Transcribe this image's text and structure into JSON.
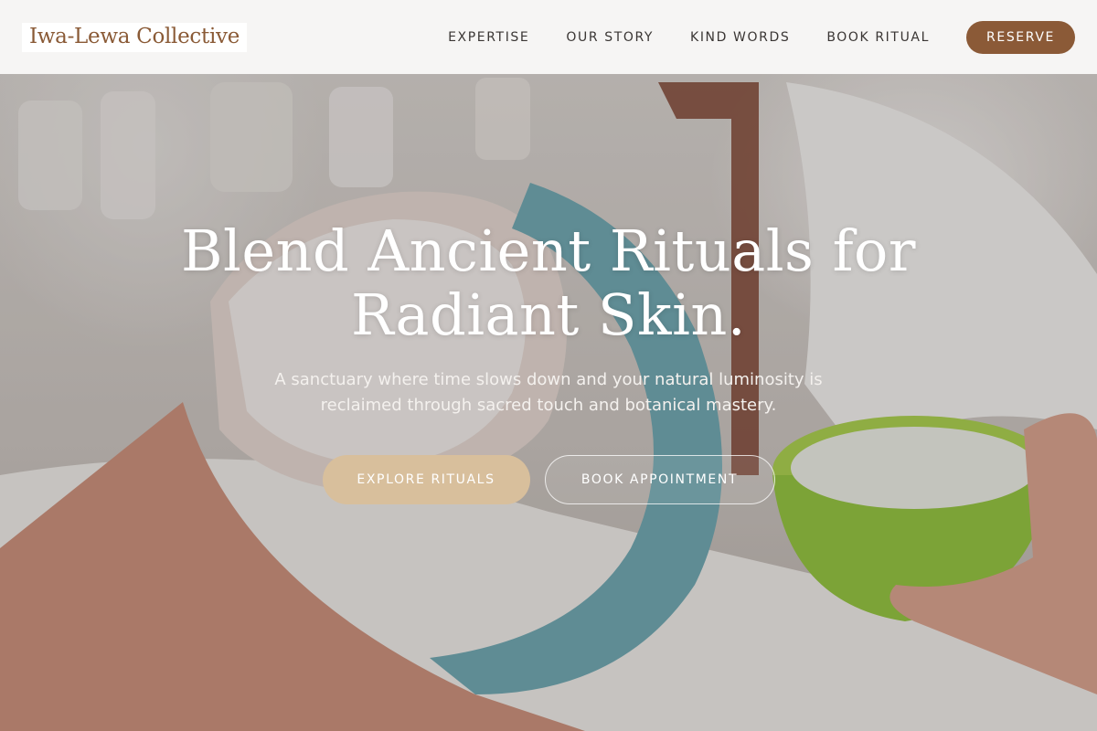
{
  "header": {
    "logo": "Iwa-Lewa Collective",
    "nav": [
      "EXPERTISE",
      "OUR STORY",
      "KIND WORDS",
      "BOOK RITUAL"
    ],
    "reserve_label": "RESERVE"
  },
  "hero": {
    "title": "Blend Ancient Rituals for Radiant Skin.",
    "subtitle": "A sanctuary where time slows down and your natural luminosity is reclaimed through sacred touch and botanical mastery.",
    "primary_cta": "EXPLORE RITUALS",
    "secondary_cta": "BOOK APPOINTMENT",
    "image": "facial-treatment-photo"
  },
  "colors": {
    "brand": "#8b5a37",
    "cta_primary": "#d8bf9c",
    "header_bg": "#f8f7f6"
  }
}
